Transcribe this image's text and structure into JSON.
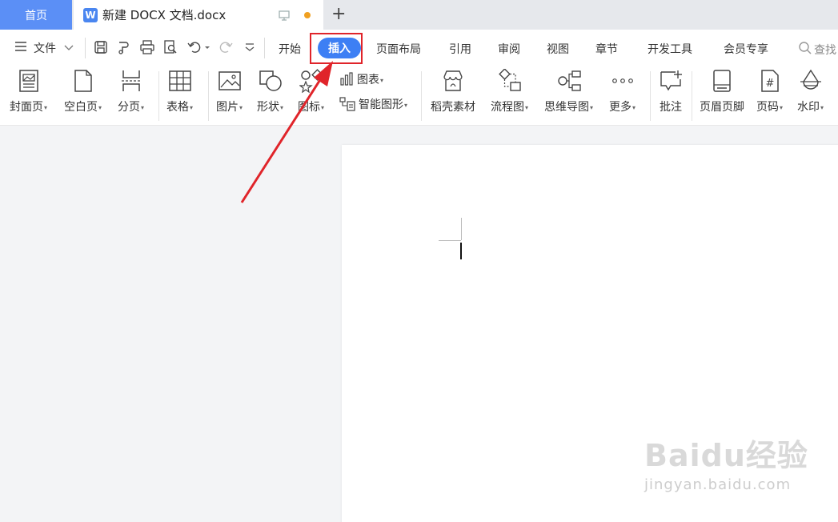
{
  "tabs": {
    "home": "首页",
    "doc_icon_letter": "W",
    "doc_title": "新建 DOCX 文档.docx",
    "new_tab": "+"
  },
  "menu": {
    "file": "文件",
    "tabs": [
      "开始",
      "插入",
      "页面布局",
      "引用",
      "审阅",
      "视图",
      "章节",
      "开发工具",
      "会员专享"
    ],
    "active_tab": "插入",
    "search": "查找"
  },
  "ribbon": {
    "cover": "封面页",
    "blank": "空白页",
    "pagebreak": "分页",
    "table": "表格",
    "picture": "图片",
    "shape": "形状",
    "icon": "图标",
    "chart": "图表",
    "smartart": "智能图形",
    "material": "稻壳素材",
    "flowchart": "流程图",
    "mindmap": "思维导图",
    "more": "更多",
    "comment": "批注",
    "header_footer": "页眉页脚",
    "page_number": "页码",
    "watermark": "水印"
  },
  "watermark": {
    "main": "Baidu经验",
    "sub": "jingyan.baidu.com"
  },
  "colors": {
    "accent": "#3d7ff4",
    "home_tab": "#5b8ff6",
    "highlight": "#e0242a",
    "arrow": "#e0242a"
  }
}
